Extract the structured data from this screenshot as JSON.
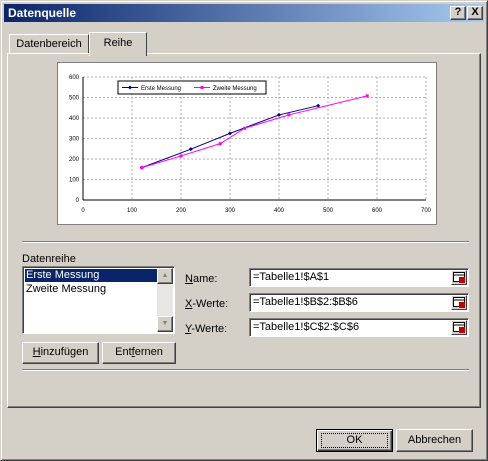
{
  "window": {
    "title": "Datenquelle",
    "help_button": "?",
    "close_button": "X"
  },
  "tabs": [
    {
      "label": "Datenbereich",
      "active": false
    },
    {
      "label": "Reihe",
      "active": true
    }
  ],
  "chart_data": {
    "type": "scatter",
    "title": "",
    "xlabel": "",
    "ylabel": "",
    "xlim": [
      0,
      700
    ],
    "ylim": [
      0,
      600
    ],
    "x_ticks": [
      "0",
      "100",
      "200",
      "300",
      "400",
      "500",
      "600",
      "700"
    ],
    "y_ticks": [
      "0",
      "100",
      "200",
      "300",
      "400",
      "500",
      "600"
    ],
    "grid": true,
    "legend_position": "top-left",
    "series": [
      {
        "name": "Erste Messung",
        "color": "#000080",
        "marker": "diamond",
        "x": [
          120,
          220,
          300,
          400,
          480
        ],
        "y": [
          158,
          248,
          325,
          415,
          460
        ]
      },
      {
        "name": "Zweite Messung",
        "color": "#ff00ff",
        "marker": "square",
        "x": [
          120,
          200,
          280,
          330,
          420,
          580
        ],
        "y": [
          158,
          215,
          275,
          350,
          415,
          508
        ]
      }
    ]
  },
  "series_group": {
    "label": "Datenreihe",
    "items": [
      "Erste Messung",
      "Zweite Messung"
    ],
    "selected_index": 0
  },
  "fields": {
    "name_label_key": "N",
    "name_label_rest": "ame:",
    "name_value": "=Tabelle1!$A$1",
    "x_label_key": "X",
    "x_label_rest": "-Werte:",
    "x_value": "=Tabelle1!$B$2:$B$6",
    "y_label_key": "Y",
    "y_label_rest": "-Werte:",
    "y_value": "=Tabelle1!$C$2:$C$6"
  },
  "buttons": {
    "add_key": "H",
    "add_rest": "inzufügen",
    "remove_pre": "Ent",
    "remove_key": "f",
    "remove_rest": "ernen",
    "ok": "OK",
    "cancel": "Abbrechen"
  }
}
